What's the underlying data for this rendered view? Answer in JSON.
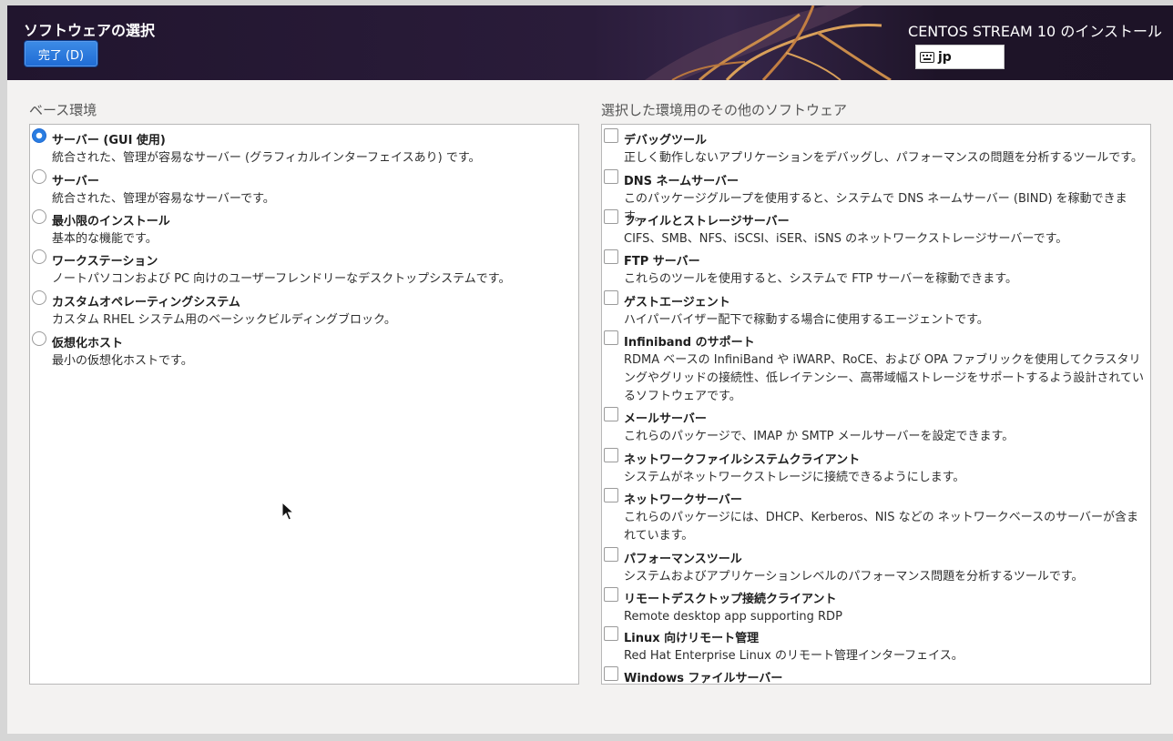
{
  "header": {
    "spoke_title": "ソフトウェアの選択",
    "done_label": "完了 (D)",
    "product_title": "CENTOS STREAM 10 のインストール",
    "keyboard_layout": "jp"
  },
  "base_env": {
    "label": "ベース環境",
    "items": [
      {
        "name": "サーバー (GUI 使用)",
        "desc": "統合された、管理が容易なサーバー (グラフィカルインターフェイスあり) です。",
        "selected": true
      },
      {
        "name": "サーバー",
        "desc": "統合された、管理が容易なサーバーです。",
        "selected": false
      },
      {
        "name": "最小限のインストール",
        "desc": "基本的な機能です。",
        "selected": false
      },
      {
        "name": "ワークステーション",
        "desc": "ノートパソコンおよび PC 向けのユーザーフレンドリーなデスクトップシステムです。",
        "selected": false
      },
      {
        "name": "カスタムオペレーティングシステム",
        "desc": "カスタム RHEL システム用のベーシックビルディングブロック。",
        "selected": false
      },
      {
        "name": "仮想化ホスト",
        "desc": "最小の仮想化ホストです。",
        "selected": false
      }
    ]
  },
  "addons": {
    "label": "選択した環境用のその他のソフトウェア",
    "items": [
      {
        "name": "デバッグツール",
        "desc": "正しく動作しないアプリケーションをデバッグし、パフォーマンスの問題を分析するツールです。",
        "checked": false
      },
      {
        "name": "DNS ネームサーバー",
        "desc": "このパッケージグループを使用すると、システムで DNS ネームサーバー (BIND) を稼動できます。",
        "checked": false
      },
      {
        "name": "ファイルとストレージサーバー",
        "desc": "CIFS、SMB、NFS、iSCSI、iSER、iSNS のネットワークストレージサーバーです。",
        "checked": false
      },
      {
        "name": "FTP サーバー",
        "desc": "これらのツールを使用すると、システムで FTP サーバーを稼動できます。",
        "checked": false
      },
      {
        "name": "ゲストエージェント",
        "desc": "ハイパーバイザー配下で稼動する場合に使用するエージェントです。",
        "checked": false
      },
      {
        "name": "Infiniband のサポート",
        "desc": "RDMA ベースの InfiniBand や iWARP、RoCE、および OPA ファブリックを使用してクラスタリングやグリッドの接続性、低レイテンシー、高帯域幅ストレージをサポートするよう設計されているソフトウェアです。",
        "checked": false
      },
      {
        "name": "メールサーバー",
        "desc": "これらのパッケージで、IMAP か SMTP メールサーバーを設定できます。",
        "checked": false
      },
      {
        "name": "ネットワークファイルシステムクライアント",
        "desc": "システムがネットワークストレージに接続できるようにします。",
        "checked": false
      },
      {
        "name": "ネットワークサーバー",
        "desc": "これらのパッケージには、DHCP、Kerberos、NIS などの ネットワークベースのサーバーが含まれています。",
        "checked": false
      },
      {
        "name": "パフォーマンスツール",
        "desc": "システムおよびアプリケーションレベルのパフォーマンス問題を分析するツールです。",
        "checked": false
      },
      {
        "name": "リモートデスクトップ接続クライアント",
        "desc": "Remote desktop app supporting RDP",
        "checked": false
      },
      {
        "name": "Linux 向けリモート管理",
        "desc": "Red Hat Enterprise Linux のリモート管理インターフェイス。",
        "checked": false
      },
      {
        "name": "Windows ファイルサーバー",
        "desc": "",
        "checked": false
      }
    ]
  },
  "colors": {
    "accent": "#2a7de1",
    "header_bg": "#21152e"
  }
}
